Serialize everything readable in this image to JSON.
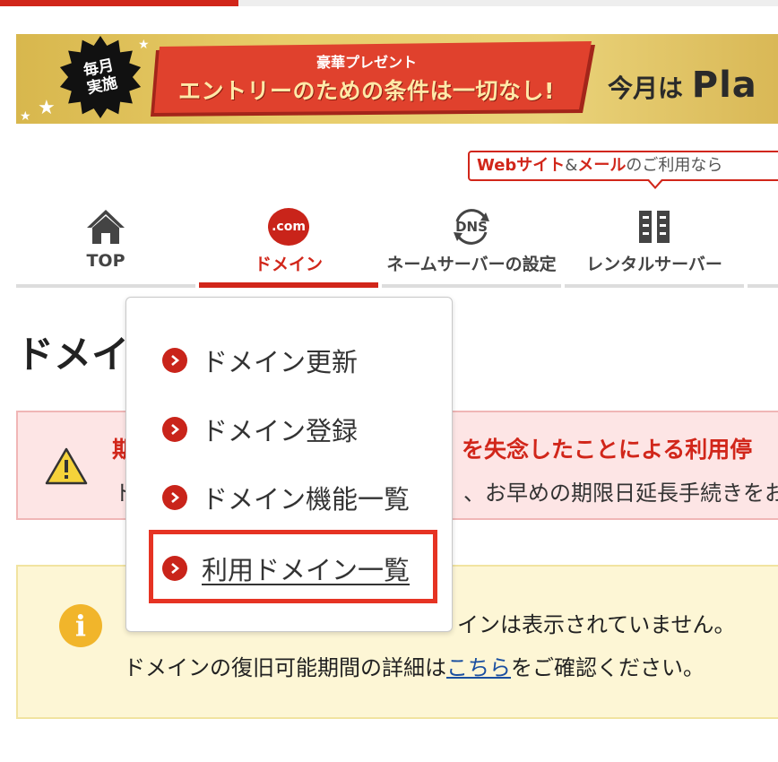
{
  "banner": {
    "badge_line1": "毎月",
    "badge_line2": "実施",
    "ribbon_small": "豪華プレゼント",
    "ribbon_big": "エントリーのための条件は一切なし!",
    "right_text": "今月は",
    "right_brand": "Pla"
  },
  "callout": {
    "red_part1": "Webサイト",
    "amp": "&",
    "red_part2": "メール",
    "rest": "のご利用なら"
  },
  "nav": {
    "items": [
      {
        "label": "TOP",
        "icon": "home-icon"
      },
      {
        "label": "ドメイン",
        "icon": "dot-com-icon",
        "icon_text": ".com"
      },
      {
        "label": "ネームサーバーの設定",
        "icon": "dns-icon",
        "icon_text": "DNS"
      },
      {
        "label": "レンタルサーバー",
        "icon": "server-icon"
      }
    ],
    "active": "ドメイン"
  },
  "page_title": "ドメイン",
  "alert_warning": {
    "title_left": "期",
    "title_right": "を失念したことによる利用停",
    "body_left": "ド",
    "body_right": "、お早めの期限日延長手続きをお"
  },
  "alert_info": {
    "line1": "インは表示されていません。",
    "line2_before": "ドメインの復旧可能期間の詳細は",
    "line2_link": "こちら",
    "line2_after": "をご確認ください。"
  },
  "dropdown": {
    "items": [
      {
        "label": "ドメイン更新"
      },
      {
        "label": "ドメイン登録"
      },
      {
        "label": "ドメイン機能一覧"
      },
      {
        "label": "利用ドメイン一覧"
      }
    ]
  },
  "colors": {
    "brand_red": "#d1261a",
    "highlight": "#e63323",
    "info_yellow": "#f1b52b"
  }
}
